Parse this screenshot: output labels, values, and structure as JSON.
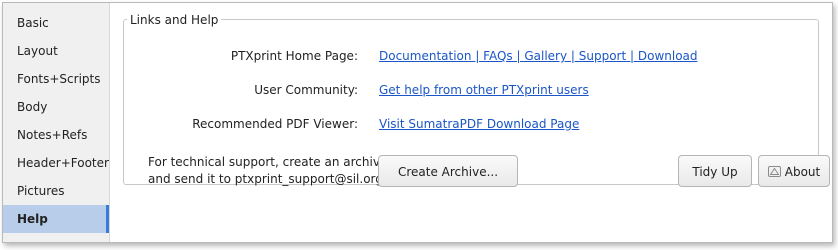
{
  "sidebar": {
    "items": [
      {
        "label": "Basic"
      },
      {
        "label": "Layout"
      },
      {
        "label": "Fonts+Scripts"
      },
      {
        "label": "Body"
      },
      {
        "label": "Notes+Refs"
      },
      {
        "label": "Header+Footer"
      },
      {
        "label": "Pictures"
      },
      {
        "label": "Help",
        "active": true
      }
    ]
  },
  "help": {
    "frame_title": "Links and Help",
    "home_label": "PTXprint Home Page:",
    "home_links": "Documentation | FAQs | Gallery | Support | Download",
    "community_label": "User Community:",
    "community_link": "Get help from other PTXprint users",
    "pdf_label": "Recommended PDF Viewer:",
    "pdf_link": "Visit SumatraPDF Download Page",
    "support_line1": "For technical support, create an archive",
    "support_line2": "and send it to ptxprint_support@sil.org",
    "create_archive_button": "Create Archive...",
    "tidy_up_button": "Tidy Up",
    "about_button": "About"
  },
  "colors": {
    "link": "#1a56c7",
    "active_item_bg": "#b7cde9",
    "active_item_accent": "#3a7bd5"
  }
}
